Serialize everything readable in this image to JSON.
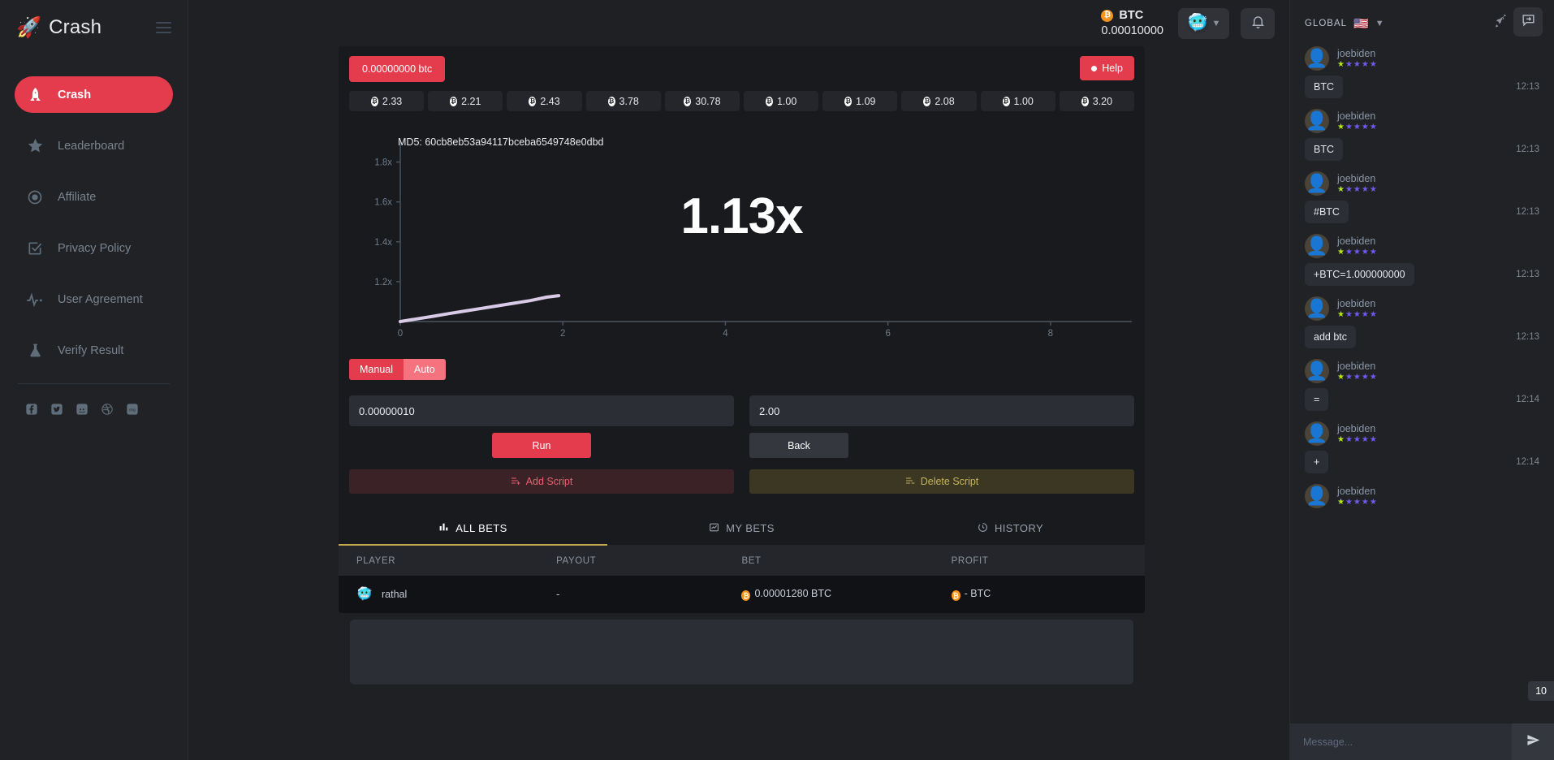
{
  "brand": {
    "name": "Crash",
    "rocket_icon": "rocket-icon"
  },
  "sidebar": {
    "items": [
      {
        "label": "Crash",
        "icon": "rocket-icon",
        "active": true
      },
      {
        "label": "Leaderboard",
        "icon": "star-icon",
        "active": false
      },
      {
        "label": "Affiliate",
        "icon": "target-icon",
        "active": false
      },
      {
        "label": "Privacy Policy",
        "icon": "checkbox-icon",
        "active": false
      },
      {
        "label": "User Agreement",
        "icon": "pulse-icon",
        "active": false
      },
      {
        "label": "Verify Result",
        "icon": "flask-icon",
        "active": false
      }
    ],
    "socials": [
      {
        "name": "facebook-icon",
        "glyph": "f"
      },
      {
        "name": "twitter-icon",
        "glyph": "t"
      },
      {
        "name": "discord-icon",
        "glyph": "d"
      },
      {
        "name": "dribbble-icon",
        "glyph": "o"
      },
      {
        "name": "mq-icon",
        "glyph": "mq"
      }
    ]
  },
  "topbar": {
    "currency": "BTC",
    "balance": "0.00010000",
    "avatar_icon": "user-avatar",
    "chevron_icon": "chevron-down-icon",
    "bell_icon": "bell-icon",
    "chat_toggle_icon": "chat-toggle-icon"
  },
  "game": {
    "bet_chip": "0.00000000 btc",
    "help_label": "Help",
    "multiplier_history": [
      "2.33",
      "2.21",
      "2.43",
      "3.78",
      "30.78",
      "1.00",
      "1.09",
      "2.08",
      "1.00",
      "3.20"
    ],
    "md5_label": "MD5: 60cb8eb53a94117bceba6549748e0dbd",
    "current_multiplier": "1.13x",
    "mode_tabs": [
      {
        "label": "Manual",
        "selected": true
      },
      {
        "label": "Auto",
        "selected": false
      }
    ],
    "bet_amount": "0.00000010",
    "auto_cashout": "2.00",
    "run_label": "Run",
    "back_label": "Back",
    "add_script_label": "Add Script",
    "delete_script_label": "Delete Script"
  },
  "chart_data": {
    "type": "line",
    "title": "MD5: 60cb8eb53a94117bceba6549748e0dbd",
    "xlabel": "",
    "ylabel": "",
    "xticks": [
      "0",
      "2",
      "4",
      "6",
      "8"
    ],
    "yticks": [
      "1.2x",
      "1.4x",
      "1.6x",
      "1.8x"
    ],
    "xlim": [
      0,
      9
    ],
    "ylim": [
      1.0,
      1.9
    ],
    "grid": false,
    "legend": "none",
    "line_color": "#d9cbe8",
    "x": [
      0.0,
      0.2,
      0.4,
      0.6,
      0.8,
      1.0,
      1.2,
      1.4,
      1.6,
      1.8,
      1.95
    ],
    "y": [
      1.0,
      1.013,
      1.026,
      1.04,
      1.053,
      1.066,
      1.079,
      1.092,
      1.105,
      1.122,
      1.13
    ]
  },
  "bets": {
    "tabs": [
      {
        "label": "ALL BETS",
        "icon": "bar-chart-icon",
        "active": true
      },
      {
        "label": "MY BETS",
        "icon": "line-chart-icon",
        "active": false
      },
      {
        "label": "HISTORY",
        "icon": "clock-icon",
        "active": false
      }
    ],
    "columns": [
      "PLAYER",
      "PAYOUT",
      "BET",
      "PROFIT"
    ],
    "rows": [
      {
        "player": "rathal",
        "payout": "-",
        "bet": "0.00001280 BTC",
        "profit": "- BTC"
      }
    ]
  },
  "chat": {
    "channel": "GLOBAL",
    "flag_icon": "us-flag-icon",
    "chevron_icon": "chevron-down-icon",
    "rocket_icon": "rocket-icon",
    "info_icon": "info-icon",
    "unread_count": "10",
    "input_placeholder": "Message...",
    "input_value": "",
    "send_icon": "send-icon",
    "messages": [
      {
        "user": "joebiden",
        "text": "BTC",
        "time": "12:13"
      },
      {
        "user": "joebiden",
        "text": "BTC",
        "time": "12:13"
      },
      {
        "user": "joebiden",
        "text": "#BTC",
        "time": "12:13"
      },
      {
        "user": "joebiden",
        "text": "+BTC=1.000000000",
        "time": "12:13"
      },
      {
        "user": "joebiden",
        "text": "add btc",
        "time": "12:13"
      },
      {
        "user": "joebiden",
        "text": "=",
        "time": "12:14"
      },
      {
        "user": "joebiden",
        "text": "+",
        "time": "12:14"
      },
      {
        "user": "joebiden",
        "text": "",
        "time": ""
      }
    ]
  },
  "colors": {
    "accent_red": "#e43c4c",
    "gold": "#c9a227",
    "btc_orange": "#f7931a",
    "panel_bg": "#191a1e",
    "page_bg": "#1e2024"
  }
}
